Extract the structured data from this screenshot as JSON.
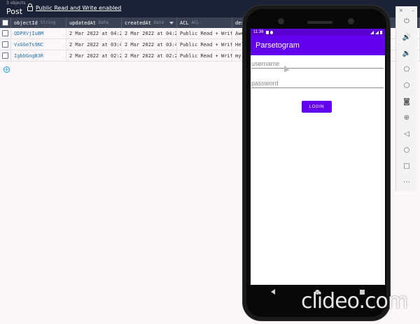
{
  "dashboard": {
    "object_count": "3 objects",
    "class_name": "Post",
    "acl_notice": "Public Read and Write enabled",
    "columns": [
      {
        "name": "objectId",
        "type": "String"
      },
      {
        "name": "updatedAt",
        "type": "Date"
      },
      {
        "name": "createdAt",
        "type": "Date"
      },
      {
        "name": "ACL",
        "type": "ACL"
      },
      {
        "name": "desc",
        "type": ""
      }
    ],
    "rows": [
      {
        "objectId": "QDP8VjIuBM",
        "updatedAt": "2 Mar 2022 at 04:2…",
        "createdAt": "2 Mar 2022 at 04:2…",
        "acl": "Public Read + Write",
        "desc": "Awe"
      },
      {
        "objectId": "VxGGeTs9NC",
        "updatedAt": "2 Mar 2022 at 03:4…",
        "createdAt": "2 Mar 2022 at 03:4…",
        "acl": "Public Read + Write",
        "desc": "Hel"
      },
      {
        "objectId": "IgbbGngB3R",
        "updatedAt": "2 Mar 2022 at 02:2…",
        "createdAt": "2 Mar 2022 at 02:2…",
        "acl": "Public Read + Write",
        "desc": "my"
      }
    ],
    "add_row_icon": "plus-circle-icon"
  },
  "phone": {
    "status_time": "11:36",
    "app_title": "Parsetogram",
    "username_placeholder": "username",
    "password_placeholder": "password",
    "login_label": "LOGIN",
    "accent_color": "#6200ee"
  },
  "toolbar": {
    "icons": [
      "power-icon",
      "volume-up-icon",
      "volume-down-icon",
      "rotate-left-icon",
      "rotate-right-icon",
      "camera-icon",
      "zoom-icon",
      "back-icon",
      "home-icon",
      "overview-icon",
      "more-icon"
    ]
  },
  "watermark": "clideo.com"
}
